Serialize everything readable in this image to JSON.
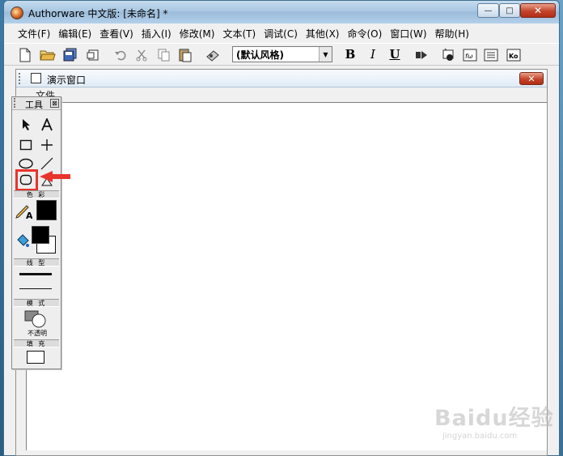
{
  "window": {
    "title": "Authorware 中文版: [未命名] *",
    "buttons": {
      "minimize": "—",
      "maximize": "□",
      "close": "✕"
    }
  },
  "menubar": {
    "items": [
      "文件(F)",
      "编辑(E)",
      "查看(V)",
      "插入(I)",
      "修改(M)",
      "文本(T)",
      "调试(C)",
      "其他(X)",
      "命令(O)",
      "窗口(W)",
      "帮助(H)"
    ]
  },
  "toolbar": {
    "style_select": "(默认风格)",
    "bold": "B",
    "italic": "I",
    "underline": "U",
    "icons": [
      "new-file-icon",
      "open-folder-icon",
      "save-all-icon",
      "import-icon",
      "undo-icon",
      "cut-icon",
      "copy-icon",
      "paste-icon",
      "find-icon",
      "run-icon",
      "control-panel-icon",
      "functions-icon",
      "variables-icon",
      "knowledge-objects-icon"
    ]
  },
  "presentation": {
    "title": "演示窗口",
    "menu": "文件",
    "close": "✕"
  },
  "tools_palette": {
    "title": "工具",
    "close": "⊠",
    "sections": {
      "colors": "色 彩",
      "line": "线 型",
      "mode": "模 式",
      "fill": "填 充"
    },
    "mode_label": "不透明",
    "highlight_color": "#e8342c"
  },
  "watermark": {
    "main": "Baidu经验",
    "sub": "jingyan.baidu.com"
  }
}
